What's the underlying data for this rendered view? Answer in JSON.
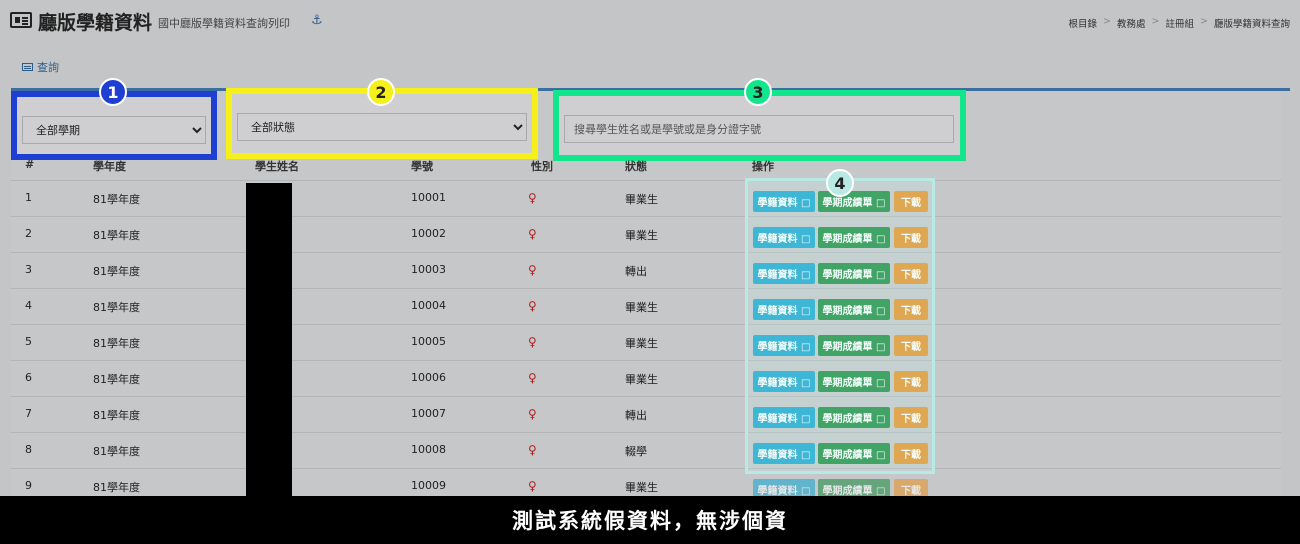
{
  "header": {
    "title": "廳版學籍資料",
    "subtitle": "國中廳版學籍資料查詢列印",
    "anchor_icon": "anchor-icon",
    "breadcrumb": [
      "根目錄",
      "教務處",
      "註冊組",
      "廳版學籍資料查詢"
    ],
    "breadcrumb_sep": ">"
  },
  "tab": {
    "label": "查詢",
    "icon": "list-icon"
  },
  "filters": {
    "term": {
      "badge": "1",
      "selected": "全部學期",
      "color": "#1e3fd1"
    },
    "status": {
      "badge": "2",
      "selected": "全部狀態",
      "color": "#f5f01a"
    },
    "search": {
      "badge": "3",
      "placeholder": "搜尋學生姓名或是學號或是身分證字號",
      "color": "#12e58c"
    }
  },
  "actions_badge": {
    "badge": "4",
    "color": "#b8e9e4"
  },
  "table": {
    "columns": [
      "#",
      "學年度",
      "學生姓名",
      "學號",
      "性別",
      "狀態",
      "操作"
    ],
    "rows": [
      {
        "no": "1",
        "year": "81學年度",
        "id": "10001",
        "gender": "♀",
        "status": "畢業生"
      },
      {
        "no": "2",
        "year": "81學年度",
        "id": "10002",
        "gender": "♀",
        "status": "畢業生"
      },
      {
        "no": "3",
        "year": "81學年度",
        "id": "10003",
        "gender": "♀",
        "status": "轉出"
      },
      {
        "no": "4",
        "year": "81學年度",
        "id": "10004",
        "gender": "♀",
        "status": "畢業生"
      },
      {
        "no": "5",
        "year": "81學年度",
        "id": "10005",
        "gender": "♀",
        "status": "畢業生"
      },
      {
        "no": "6",
        "year": "81學年度",
        "id": "10006",
        "gender": "♀",
        "status": "畢業生"
      },
      {
        "no": "7",
        "year": "81學年度",
        "id": "10007",
        "gender": "♀",
        "status": "轉出"
      },
      {
        "no": "8",
        "year": "81學年度",
        "id": "10008",
        "gender": "♀",
        "status": "輟學"
      },
      {
        "no": "9",
        "year": "81學年度",
        "id": "10009",
        "gender": "♀",
        "status": "畢業生"
      }
    ],
    "buttons": {
      "info": "學籍資料 □",
      "grade": "學期成績單 □",
      "download": "下載"
    }
  },
  "footer": {
    "text": "測試系統假資料，無涉個資"
  }
}
